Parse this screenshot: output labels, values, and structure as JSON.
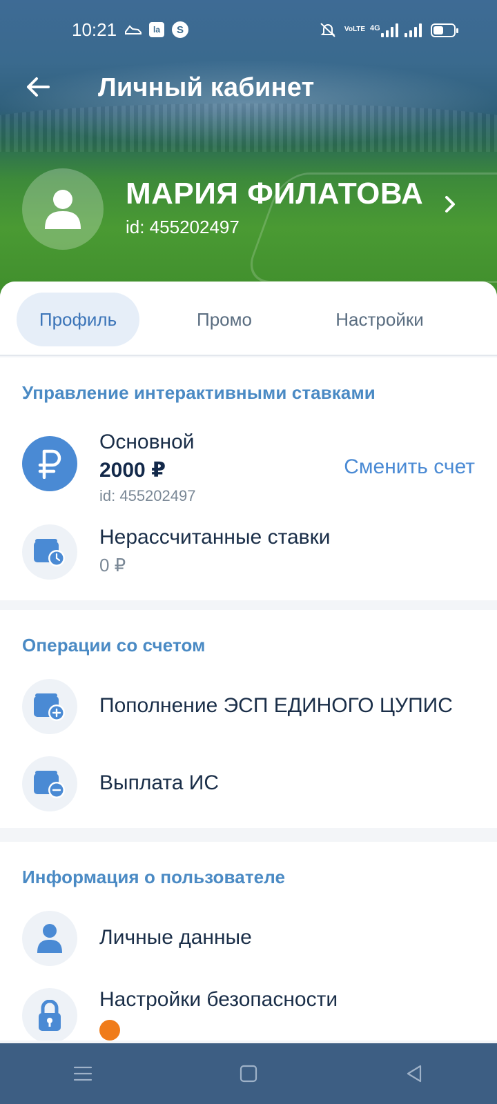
{
  "status_bar": {
    "time": "10:21",
    "notif_box_label": "la",
    "notif_circle_label": "S",
    "network_label": "4G",
    "volte_label": "VoLTE",
    "battery_level": 0.5
  },
  "header": {
    "title": "Личный кабинет"
  },
  "profile": {
    "name": "МАРИЯ ФИЛАТОВА",
    "id_text": "id: 455202497"
  },
  "tabs": [
    {
      "label": "Профиль",
      "active": true
    },
    {
      "label": "Промо",
      "active": false
    },
    {
      "label": "Настройки",
      "active": false
    }
  ],
  "sections": {
    "bets": {
      "title": "Управление интерактивными ставками",
      "account": {
        "name": "Основной",
        "balance": "2000 ₽",
        "id_text": "id: 455202497",
        "change_label": "Сменить счет",
        "currency_symbol": "₽"
      },
      "unsettled": {
        "title": "Нерассчитанные ставки",
        "value": "0 ₽"
      }
    },
    "operations": {
      "title": "Операции со счетом",
      "items": [
        {
          "label": "Пополнение ЭСП ЕДИНОГО ЦУПИС",
          "icon": "wallet-plus-icon"
        },
        {
          "label": "Выплата ИС",
          "icon": "wallet-minus-icon"
        }
      ]
    },
    "user_info": {
      "title": "Информация о пользователе",
      "items": [
        {
          "label": "Личные данные",
          "icon": "person-icon"
        },
        {
          "label": "Настройки безопасности",
          "icon": "lock-icon"
        }
      ]
    }
  },
  "colors": {
    "accent": "#4a8ad4",
    "section_title": "#4a8ac4",
    "text_primary": "#1a2e48",
    "navbar": "#3d5e83"
  }
}
